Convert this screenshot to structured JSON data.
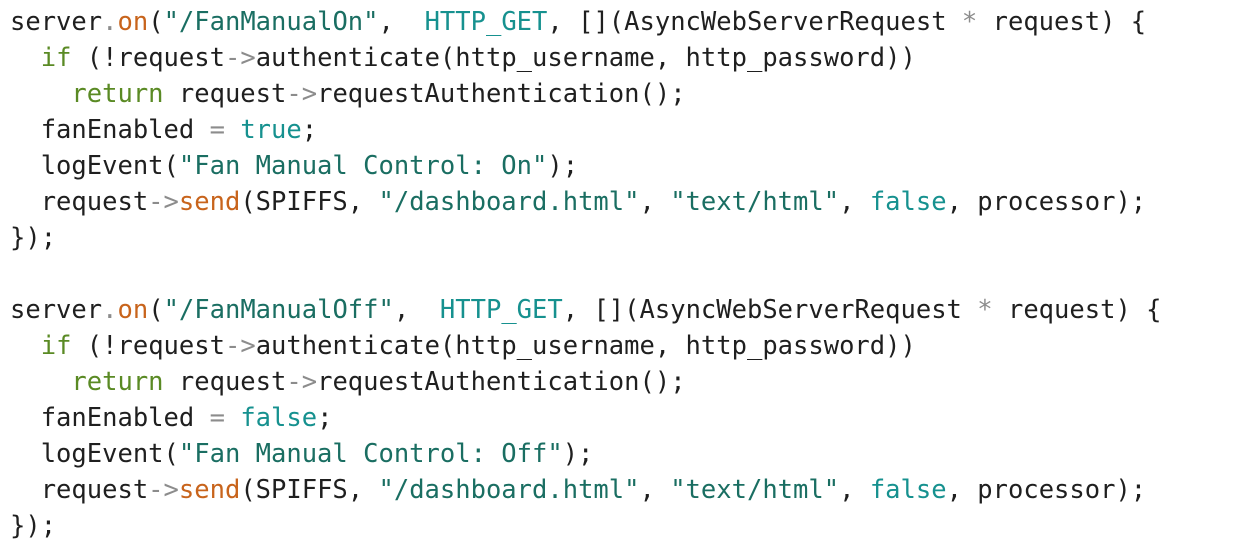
{
  "code": {
    "lines": [
      [
        {
          "t": "server",
          "k": "plain"
        },
        {
          "t": ".",
          "k": "op"
        },
        {
          "t": "on",
          "k": "method"
        },
        {
          "t": "(",
          "k": "plain"
        },
        {
          "t": "\"/FanManualOn\"",
          "k": "string"
        },
        {
          "t": ",  ",
          "k": "plain"
        },
        {
          "t": "HTTP_GET",
          "k": "const"
        },
        {
          "t": ", [](AsyncWebServerRequest ",
          "k": "plain"
        },
        {
          "t": "*",
          "k": "op"
        },
        {
          "t": " request) {",
          "k": "plain"
        }
      ],
      [
        {
          "t": "  ",
          "k": "plain"
        },
        {
          "t": "if",
          "k": "keyword"
        },
        {
          "t": " (!request",
          "k": "plain"
        },
        {
          "t": "->",
          "k": "op"
        },
        {
          "t": "authenticate(http_username, http_password))",
          "k": "plain"
        }
      ],
      [
        {
          "t": "    ",
          "k": "plain"
        },
        {
          "t": "return",
          "k": "keyword"
        },
        {
          "t": " request",
          "k": "plain"
        },
        {
          "t": "->",
          "k": "op"
        },
        {
          "t": "requestAuthentication();",
          "k": "plain"
        }
      ],
      [
        {
          "t": "  fanEnabled ",
          "k": "plain"
        },
        {
          "t": "=",
          "k": "op"
        },
        {
          "t": " ",
          "k": "plain"
        },
        {
          "t": "true",
          "k": "const"
        },
        {
          "t": ";",
          "k": "plain"
        }
      ],
      [
        {
          "t": "  logEvent(",
          "k": "plain"
        },
        {
          "t": "\"Fan Manual Control: On\"",
          "k": "string"
        },
        {
          "t": ");",
          "k": "plain"
        }
      ],
      [
        {
          "t": "  request",
          "k": "plain"
        },
        {
          "t": "->",
          "k": "op"
        },
        {
          "t": "send",
          "k": "method"
        },
        {
          "t": "(SPIFFS, ",
          "k": "plain"
        },
        {
          "t": "\"/dashboard.html\"",
          "k": "string"
        },
        {
          "t": ", ",
          "k": "plain"
        },
        {
          "t": "\"text/html\"",
          "k": "string"
        },
        {
          "t": ", ",
          "k": "plain"
        },
        {
          "t": "false",
          "k": "const"
        },
        {
          "t": ", processor);",
          "k": "plain"
        }
      ],
      [
        {
          "t": "});",
          "k": "plain"
        }
      ],
      [],
      [
        {
          "t": "server",
          "k": "plain"
        },
        {
          "t": ".",
          "k": "op"
        },
        {
          "t": "on",
          "k": "method"
        },
        {
          "t": "(",
          "k": "plain"
        },
        {
          "t": "\"/FanManualOff\"",
          "k": "string"
        },
        {
          "t": ",  ",
          "k": "plain"
        },
        {
          "t": "HTTP_GET",
          "k": "const"
        },
        {
          "t": ", [](AsyncWebServerRequest ",
          "k": "plain"
        },
        {
          "t": "*",
          "k": "op"
        },
        {
          "t": " request) {",
          "k": "plain"
        }
      ],
      [
        {
          "t": "  ",
          "k": "plain"
        },
        {
          "t": "if",
          "k": "keyword"
        },
        {
          "t": " (!request",
          "k": "plain"
        },
        {
          "t": "->",
          "k": "op"
        },
        {
          "t": "authenticate(http_username, http_password))",
          "k": "plain"
        }
      ],
      [
        {
          "t": "    ",
          "k": "plain"
        },
        {
          "t": "return",
          "k": "keyword"
        },
        {
          "t": " request",
          "k": "plain"
        },
        {
          "t": "->",
          "k": "op"
        },
        {
          "t": "requestAuthentication();",
          "k": "plain"
        }
      ],
      [
        {
          "t": "  fanEnabled ",
          "k": "plain"
        },
        {
          "t": "=",
          "k": "op"
        },
        {
          "t": " ",
          "k": "plain"
        },
        {
          "t": "false",
          "k": "const"
        },
        {
          "t": ";",
          "k": "plain"
        }
      ],
      [
        {
          "t": "  logEvent(",
          "k": "plain"
        },
        {
          "t": "\"Fan Manual Control: Off\"",
          "k": "string"
        },
        {
          "t": ");",
          "k": "plain"
        }
      ],
      [
        {
          "t": "  request",
          "k": "plain"
        },
        {
          "t": "->",
          "k": "op"
        },
        {
          "t": "send",
          "k": "method"
        },
        {
          "t": "(SPIFFS, ",
          "k": "plain"
        },
        {
          "t": "\"/dashboard.html\"",
          "k": "string"
        },
        {
          "t": ", ",
          "k": "plain"
        },
        {
          "t": "\"text/html\"",
          "k": "string"
        },
        {
          "t": ", ",
          "k": "plain"
        },
        {
          "t": "false",
          "k": "const"
        },
        {
          "t": ", processor);",
          "k": "plain"
        }
      ],
      [
        {
          "t": "});",
          "k": "plain"
        }
      ]
    ]
  },
  "theme": {
    "background": "#ffffff",
    "plain": "#1f1f1f",
    "method": "#c8641c",
    "string": "#1a6e62",
    "const": "#16918f",
    "keyword": "#5a8a24",
    "operator": "#8c8c8c"
  }
}
